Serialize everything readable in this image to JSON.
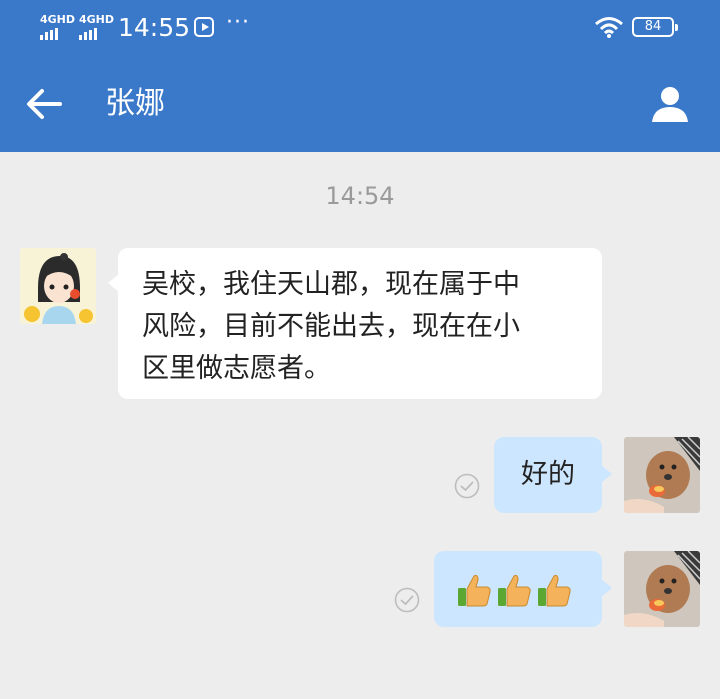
{
  "status_bar": {
    "signal_1": "4GHD",
    "signal_2": "4GHD",
    "time": "14:55",
    "more": "···",
    "battery": "84"
  },
  "header": {
    "title": "张娜"
  },
  "chat": {
    "timestamp": "14:54",
    "messages": [
      {
        "from": "other",
        "lines": [
          "吴校，我住天山郡，现在属于中",
          "风险，目前不能出去，现在在小",
          "区里做志愿者。"
        ]
      },
      {
        "from": "me",
        "text": "好的"
      },
      {
        "from": "me",
        "emoji": "👍👍👍"
      }
    ]
  },
  "colors": {
    "header_bg": "#3a78c9",
    "chat_bg": "#ededed",
    "bubble_other": "#ffffff",
    "bubble_me": "#cde6ff"
  }
}
